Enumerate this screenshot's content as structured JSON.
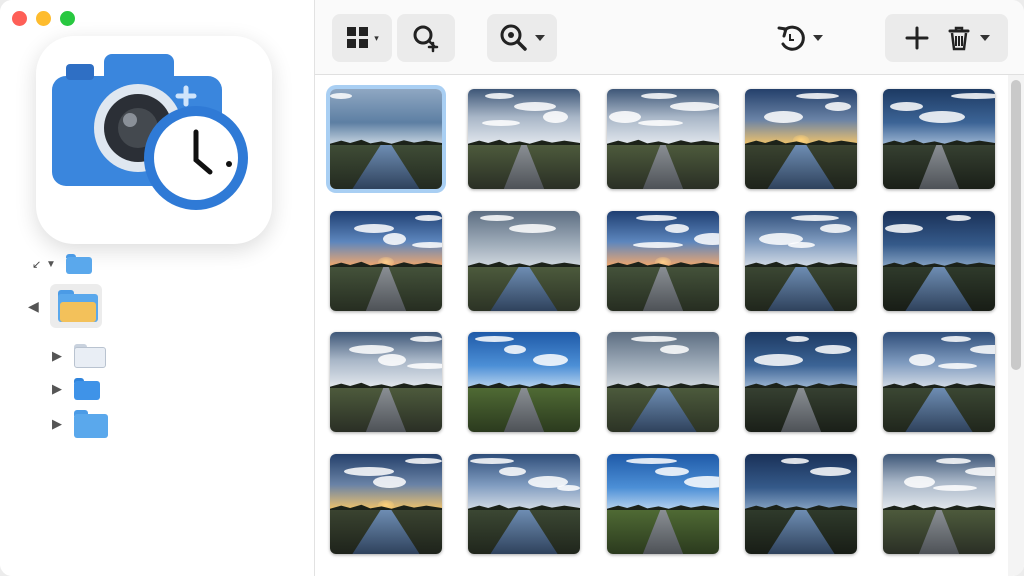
{
  "window": {
    "traffic_lights": {
      "close": "#fe5f57",
      "minimize": "#febc2e",
      "maximize": "#28c840"
    }
  },
  "app_icon": {
    "name": "camera-clock-icon",
    "camera_color": "#3a86dd",
    "clock_ring": "#2f7ad6"
  },
  "sidebar": {
    "tree": [
      {
        "name": "folder-root",
        "expanded": true,
        "color": "#5aa8ec"
      },
      {
        "name": "folder-selected",
        "expanded": false,
        "color": "#f3c15a",
        "selected": true
      },
      {
        "name": "folder-child-1",
        "expanded": false,
        "color": "#e9eef5"
      },
      {
        "name": "folder-child-2",
        "expanded": false,
        "color": "#3f93e8"
      },
      {
        "name": "folder-child-3",
        "expanded": false,
        "color": "#5aa8ec"
      }
    ]
  },
  "toolbar": {
    "buttons": [
      {
        "name": "view-mode-button",
        "icon": "grid-icon",
        "has_menu": true
      },
      {
        "name": "search-button",
        "icon": "search-icon",
        "has_menu": false
      },
      {
        "name": "zoom-button",
        "icon": "zoom-icon",
        "has_menu": true
      },
      {
        "name": "rotate-button",
        "icon": "rotate-left-icon",
        "has_menu": true
      },
      {
        "name": "add-button",
        "icon": "plus-icon",
        "has_menu": false
      },
      {
        "name": "delete-button",
        "icon": "trash-icon",
        "has_menu": true
      }
    ]
  },
  "photos": {
    "accent": "#a9cff3",
    "selected_index": 0,
    "items": [
      {
        "variant": "dusk-canal"
      },
      {
        "variant": "cloud-road"
      },
      {
        "variant": "cloud-road"
      },
      {
        "variant": "sunset-canal"
      },
      {
        "variant": "night-road"
      },
      {
        "variant": "sunset-road"
      },
      {
        "variant": "grey-lake"
      },
      {
        "variant": "sunset-road"
      },
      {
        "variant": "cloud-canal"
      },
      {
        "variant": "night-canal"
      },
      {
        "variant": "cloud-road"
      },
      {
        "variant": "blue-field"
      },
      {
        "variant": "grey-lake"
      },
      {
        "variant": "night-road"
      },
      {
        "variant": "cloud-canal"
      },
      {
        "variant": "sunset-canal"
      },
      {
        "variant": "cloud-canal"
      },
      {
        "variant": "blue-field"
      },
      {
        "variant": "night-canal"
      },
      {
        "variant": "cloud-road"
      }
    ]
  }
}
